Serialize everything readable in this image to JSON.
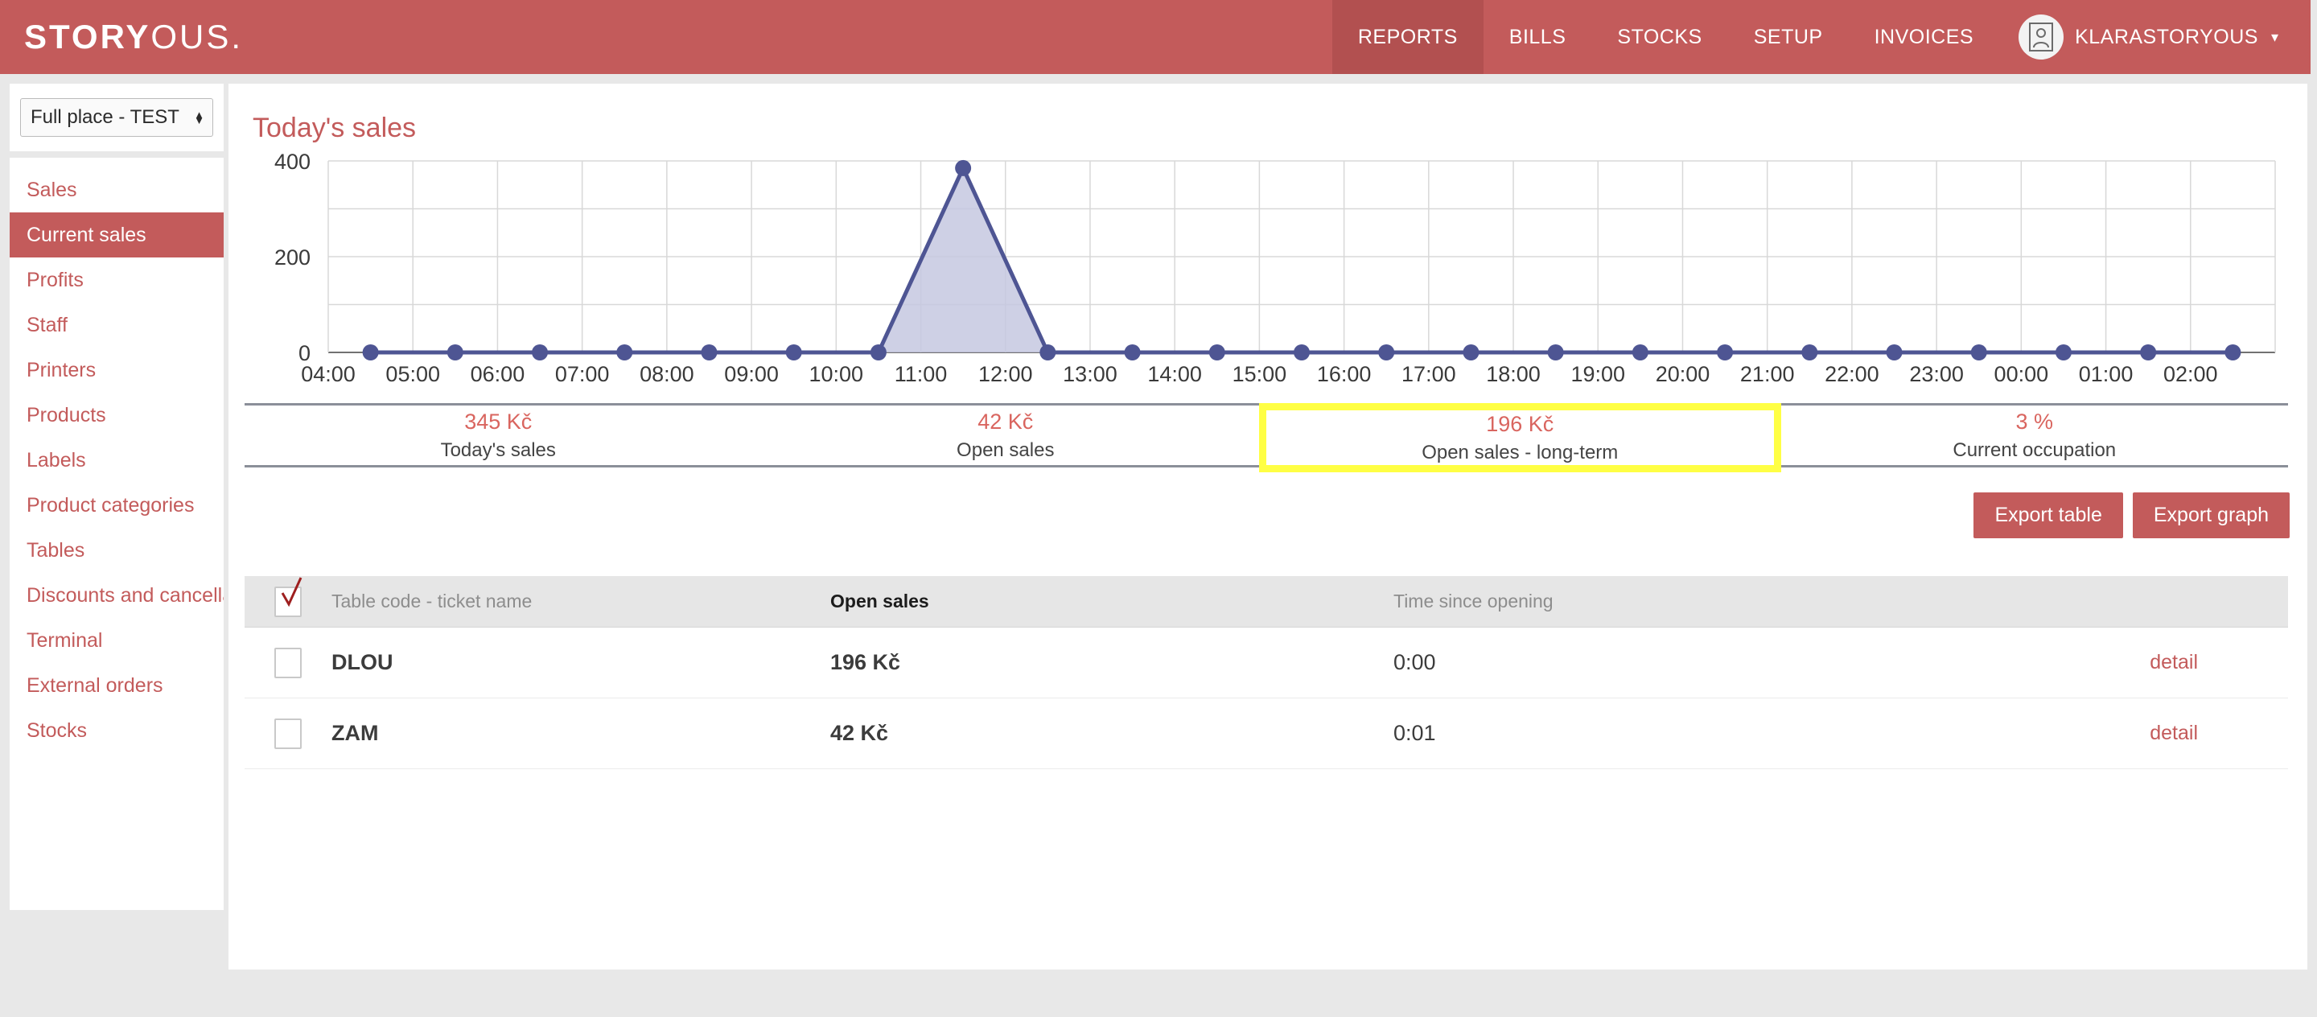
{
  "brand": {
    "bold_part": "STORY",
    "thin_part": "OUS.",
    "accent": "#c35b5b",
    "accent_dark": "#b25050"
  },
  "topnav": {
    "items": [
      {
        "label": "REPORTS",
        "active": true
      },
      {
        "label": "BILLS",
        "active": false
      },
      {
        "label": "STOCKS",
        "active": false
      },
      {
        "label": "SETUP",
        "active": false
      },
      {
        "label": "INVOICES",
        "active": false
      }
    ],
    "user": {
      "name": "KLARASTORYOUS",
      "caret": "▾",
      "avatar_icon": "user-portrait-icon"
    }
  },
  "sidebar": {
    "place_select": {
      "value": "Full place - TEST",
      "arrow_up": "▲",
      "arrow_down": "▼"
    },
    "items": [
      {
        "label": "Sales",
        "active": false
      },
      {
        "label": "Current sales",
        "active": true
      },
      {
        "label": "Profits",
        "active": false
      },
      {
        "label": "Staff",
        "active": false
      },
      {
        "label": "Printers",
        "active": false
      },
      {
        "label": "Products",
        "active": false
      },
      {
        "label": "Labels",
        "active": false
      },
      {
        "label": "Product categories",
        "active": false
      },
      {
        "label": "Tables",
        "active": false
      },
      {
        "label": "Discounts and cancellations",
        "active": false
      },
      {
        "label": "Terminal",
        "active": false
      },
      {
        "label": "External orders",
        "active": false
      },
      {
        "label": "Stocks",
        "active": false
      }
    ]
  },
  "main": {
    "page_title": "Today's sales",
    "stats": [
      {
        "value": "345 Kč",
        "label": "Today's sales",
        "highlighted": false
      },
      {
        "value": "42 Kč",
        "label": "Open sales",
        "highlighted": false
      },
      {
        "value": "196 Kč",
        "label": "Open sales - long-term",
        "highlighted": true
      },
      {
        "value": "3 %",
        "label": "Current occupation",
        "highlighted": false
      }
    ],
    "highlight_color": "#ffff44",
    "buttons": {
      "export_table": "Export table",
      "export_graph": "Export graph"
    },
    "table": {
      "header_checkbox_checked": true,
      "columns": [
        "Table code - ticket name",
        "Open sales",
        "Time since opening"
      ],
      "rows": [
        {
          "checked": false,
          "code": "DLOU",
          "open_sales": "196 Kč",
          "time": "0:00",
          "detail": "detail"
        },
        {
          "checked": false,
          "code": "ZAM",
          "open_sales": "42 Kč",
          "time": "0:01",
          "detail": "detail"
        }
      ]
    }
  },
  "chart_data": {
    "type": "area",
    "title": "Today's sales",
    "xlabel": "",
    "ylabel": "",
    "ylim": [
      0,
      400
    ],
    "yticks": [
      0,
      200,
      400
    ],
    "ytick_labels": [
      "0",
      "200",
      "400"
    ],
    "gridlines_y": [
      0,
      100,
      200,
      300,
      400
    ],
    "grid": true,
    "legend": "none",
    "line_color": "#4e5593",
    "fill_color": "#c5c8e0",
    "x": [
      "04:00",
      "05:00",
      "06:00",
      "07:00",
      "08:00",
      "09:00",
      "10:00",
      "11:00",
      "12:00",
      "13:00",
      "14:00",
      "15:00",
      "16:00",
      "17:00",
      "18:00",
      "19:00",
      "20:00",
      "21:00",
      "22:00",
      "23:00",
      "00:00",
      "01:00",
      "02:00"
    ],
    "values": [
      0,
      0,
      0,
      0,
      0,
      0,
      0,
      385,
      0,
      0,
      0,
      0,
      0,
      0,
      0,
      0,
      0,
      0,
      0,
      0,
      0,
      0,
      0
    ],
    "note": "data points are drawn offset half a step to the right of each hour label"
  }
}
